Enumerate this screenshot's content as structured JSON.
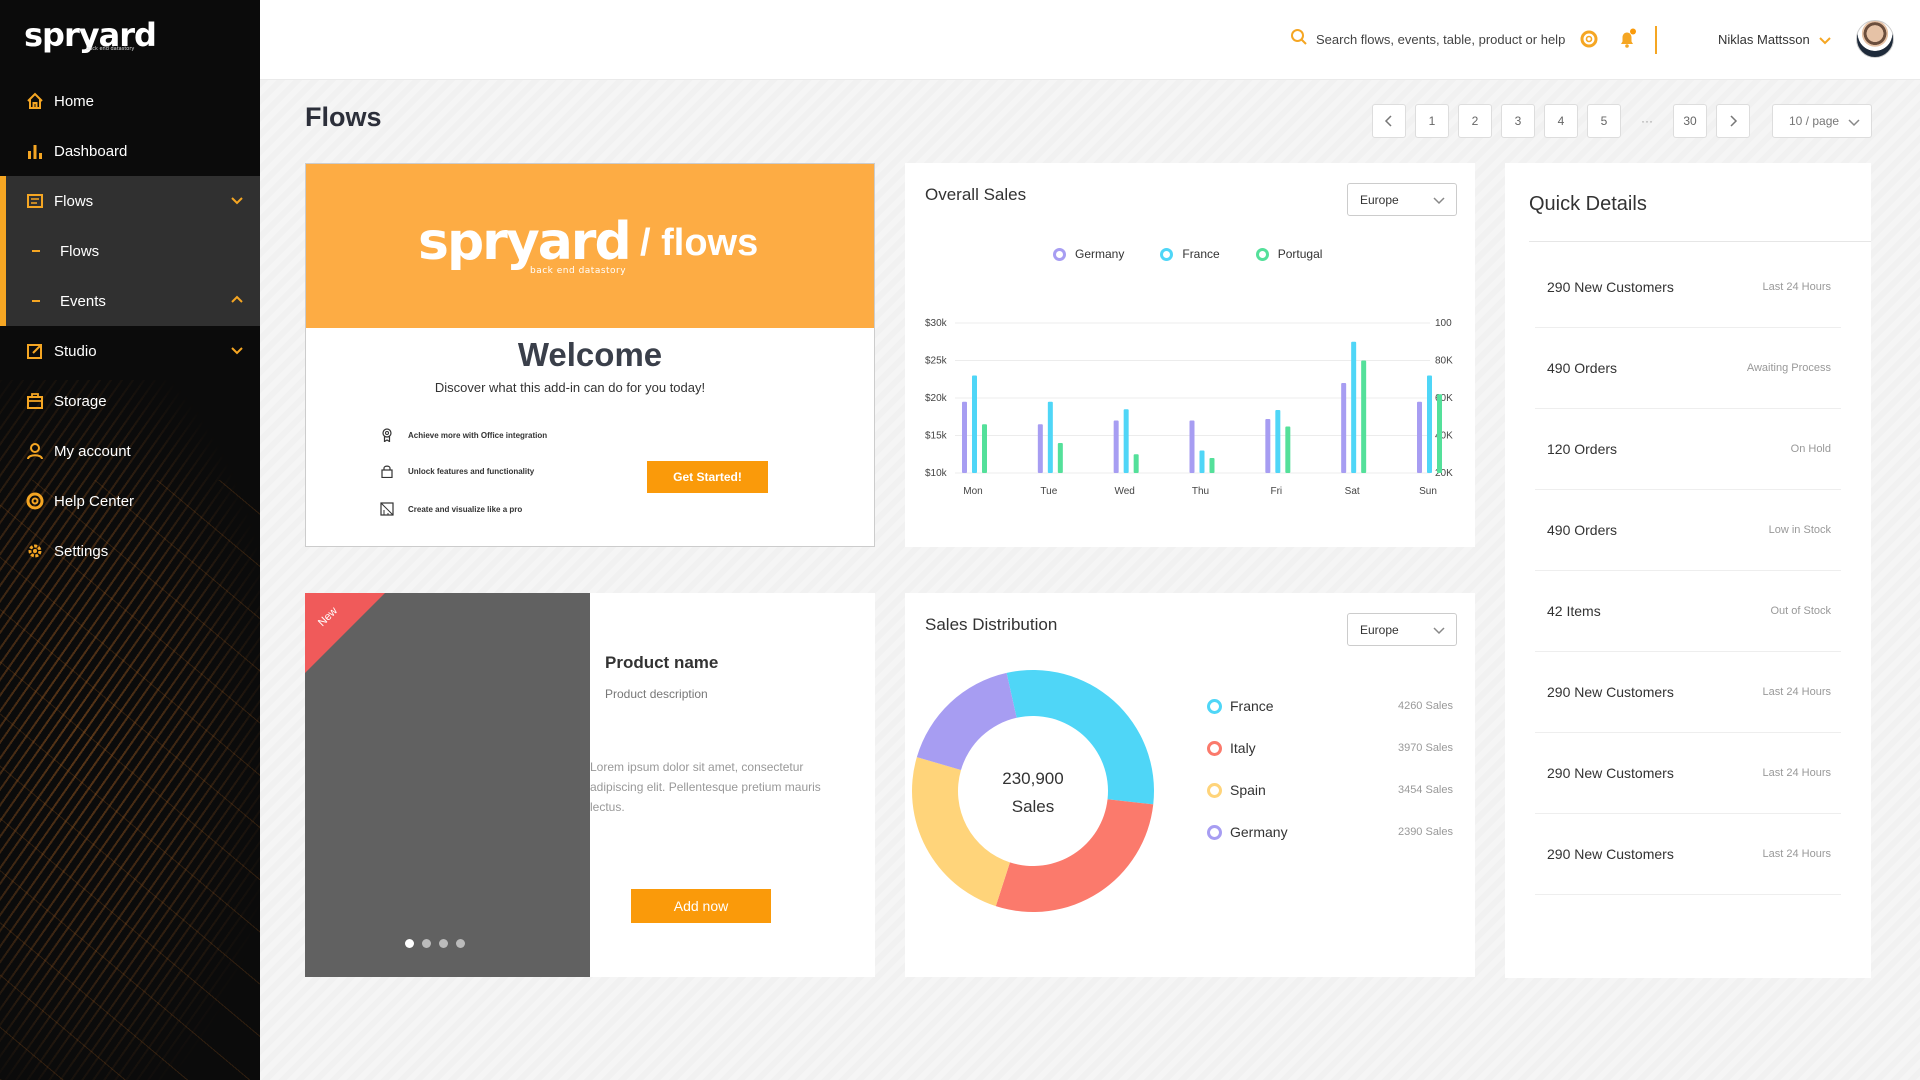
{
  "app": {
    "logo": "spryard",
    "logo_tagline": "back end datastory"
  },
  "sidebar": {
    "items": [
      {
        "label": "Home",
        "icon": "home-icon"
      },
      {
        "label": "Dashboard",
        "icon": "bar-chart-icon"
      },
      {
        "label": "Flows",
        "icon": "flows-icon"
      },
      {
        "label": "Flows",
        "icon": "dash-icon"
      },
      {
        "label": "Events",
        "icon": "dash-icon"
      },
      {
        "label": "Studio",
        "icon": "edit-icon"
      },
      {
        "label": "Storage",
        "icon": "storage-icon"
      },
      {
        "label": "My account",
        "icon": "user-icon"
      },
      {
        "label": "Help Center",
        "icon": "lifebuoy-icon"
      },
      {
        "label": "Settings",
        "icon": "gear-icon"
      }
    ]
  },
  "header": {
    "search_placeholder": "Search flows, events, table, product or help",
    "user_name": "Niklas Mattsson"
  },
  "page": {
    "title": "Flows",
    "pagination": {
      "pages": [
        "1",
        "2",
        "3",
        "4",
        "5"
      ],
      "ellipsis": "···",
      "last": "30",
      "per_page": "10 / page"
    }
  },
  "welcome": {
    "banner_logo": "spryard",
    "banner_tagline": "back end datastory",
    "banner_suffix": "/ flows",
    "title": "Welcome",
    "subtitle": "Discover what this add-in can do for you today!",
    "features": [
      {
        "text": "Achieve more with Office integration",
        "icon": "badge-icon"
      },
      {
        "text": "Unlock features and functionality",
        "icon": "lock-icon"
      },
      {
        "text": "Create and visualize like a pro",
        "icon": "design-icon"
      }
    ],
    "cta": "Get Started!"
  },
  "overall_sales": {
    "title": "Overall Sales",
    "region": "Europe",
    "legend": [
      "Germany",
      "France",
      "Portugal"
    ]
  },
  "product": {
    "badge": "New",
    "name": "Product name",
    "description": "Product description",
    "lorem": "Lorem ipsum dolor sit amet, consectetur adipiscing elit. Pellentesque pretium mauris lectus.",
    "cta": "Add now",
    "slides": 4,
    "active_slide": 0
  },
  "distribution": {
    "title": "Sales Distribution",
    "region": "Europe",
    "total": "230,900",
    "total_label": "Sales",
    "rows": [
      {
        "name": "France",
        "value": "4260 Sales",
        "color": "#4fd6f7"
      },
      {
        "name": "Italy",
        "value": "3970 Sales",
        "color": "#fb7a6c"
      },
      {
        "name": "Spain",
        "value": "3454 Sales",
        "color": "#ffd47a"
      },
      {
        "name": "Germany",
        "value": "2390 Sales",
        "color": "#a79df2"
      }
    ]
  },
  "quick_details": {
    "title": "Quick Details",
    "rows": [
      {
        "label": "290 New Customers",
        "meta": "Last 24 Hours"
      },
      {
        "label": "490 Orders",
        "meta": "Awaiting Process"
      },
      {
        "label": "120 Orders",
        "meta": "On Hold"
      },
      {
        "label": "490 Orders",
        "meta": "Low in Stock"
      },
      {
        "label": "42 Items",
        "meta": "Out of Stock"
      },
      {
        "label": "290 New Customers",
        "meta": "Last 24 Hours"
      },
      {
        "label": "290 New Customers",
        "meta": "Last 24 Hours"
      },
      {
        "label": "290 New Customers",
        "meta": "Last 24 Hours"
      }
    ]
  },
  "colors": {
    "accent": "#f5a623",
    "button": "#fa9a0a",
    "germany": "#a79df2",
    "france": "#4fd6f7",
    "portugal": "#54e09a"
  },
  "chart_data": [
    {
      "type": "bar",
      "title": "Overall Sales",
      "categories": [
        "Mon",
        "Tue",
        "Wed",
        "Thu",
        "Fri",
        "Sat",
        "Sun"
      ],
      "series": [
        {
          "name": "Germany",
          "values": [
            19.5,
            16.5,
            17,
            17,
            17.2,
            22,
            19.5
          ]
        },
        {
          "name": "France",
          "values": [
            23,
            19.5,
            18.5,
            13,
            18.4,
            27.5,
            23
          ]
        },
        {
          "name": "Portugal",
          "values": [
            16.5,
            14,
            12.5,
            12,
            16.2,
            25,
            20.5
          ]
        }
      ],
      "ylim": [
        10,
        30
      ],
      "y_ticks": [
        "$10k",
        "$15k",
        "$20k",
        "$25k",
        "$30k"
      ],
      "y2_ticks": [
        "20K",
        "40K",
        "60K",
        "80K",
        "100"
      ],
      "grid": true,
      "legend": "top"
    },
    {
      "type": "pie",
      "title": "Sales Distribution",
      "categories": [
        "France",
        "Italy",
        "Spain",
        "Germany"
      ],
      "values": [
        4260,
        3970,
        3454,
        2390
      ],
      "donut": true
    }
  ]
}
